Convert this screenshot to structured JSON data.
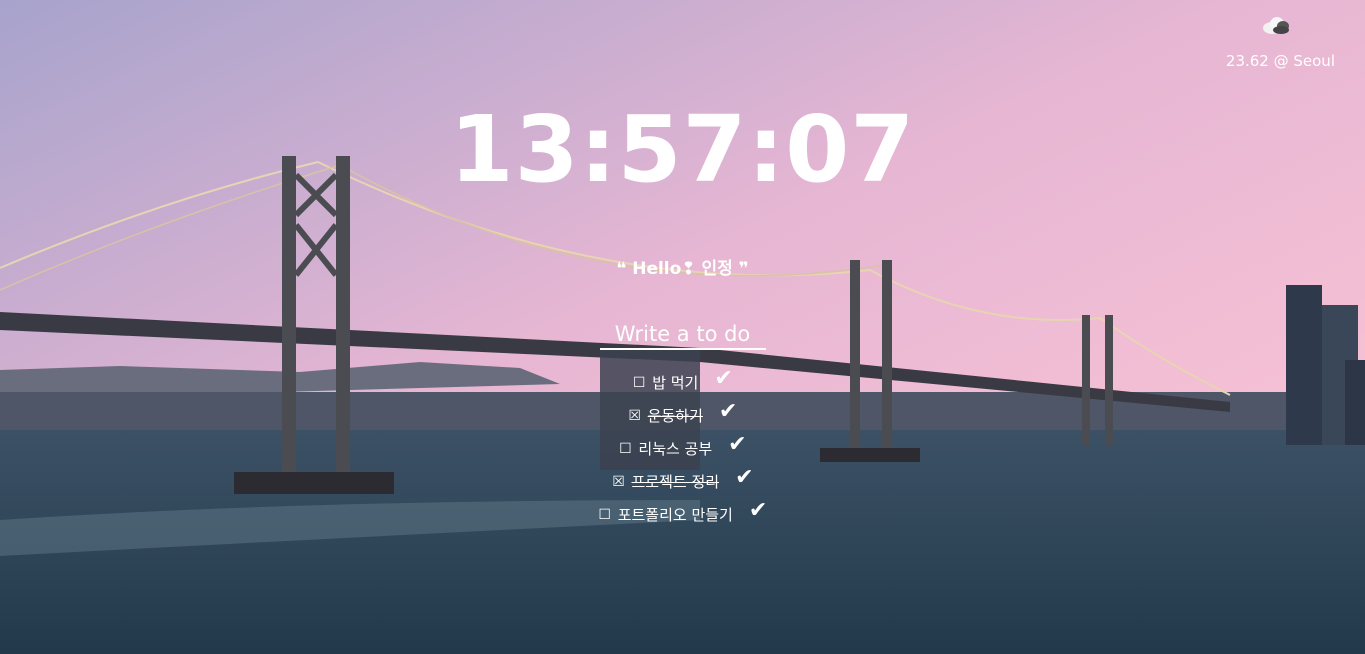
{
  "weather": {
    "icon": "cloud-icon",
    "text": "23.62 @ Seoul"
  },
  "clock": {
    "time": "13:57:07"
  },
  "greeting": {
    "text": "❝ Hello❢  인정 ❞"
  },
  "todo_form": {
    "placeholder": "Write a to do"
  },
  "todos": [
    {
      "box": "☐",
      "text": "밥 먹기",
      "done": false,
      "check": "✔"
    },
    {
      "box": "☒",
      "text": "운동하기",
      "done": true,
      "check": "✔"
    },
    {
      "box": "☐",
      "text": "리눅스 공부",
      "done": false,
      "check": "✔"
    },
    {
      "box": "☒",
      "text": "프로젝트 정리",
      "done": true,
      "check": "✔"
    },
    {
      "box": "☐",
      "text": "포트폴리오 만들기",
      "done": false,
      "check": "✔"
    }
  ]
}
